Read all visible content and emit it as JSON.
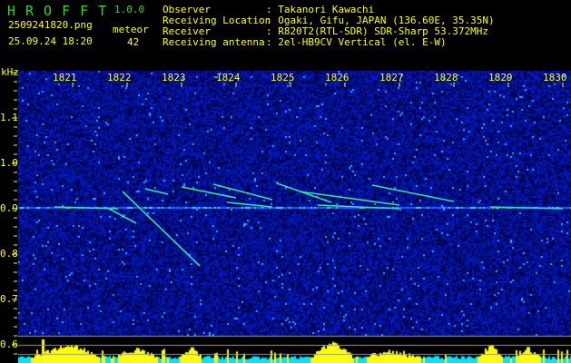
{
  "header": {
    "app_title": "HROFFT",
    "version": "1.0.0",
    "filename": "2509241820.png",
    "datetime": "25.09.24 18:20",
    "meteor_label": "meteor",
    "meteor_count": "42",
    "fields": [
      {
        "label": "Observer",
        "value": ": Takanori Kawachi"
      },
      {
        "label": "Receiving Location",
        "value": ": Ogaki, Gifu, JAPAN (136.60E, 35.35N)"
      },
      {
        "label": "Receiver",
        "value": ": R820T2(RTL-SDR) SDR-Sharp 53.372MHz"
      },
      {
        "label": "Receiving antenna",
        "value": ": 2el-HB9CV Vertical (el. E-W)"
      }
    ]
  },
  "axis": {
    "y_unit": "kHz",
    "y_ticks": [
      "1.1",
      "1.0",
      "0.9",
      "0.8",
      "0.7",
      "0.6"
    ],
    "x_ticks": [
      "1821",
      "1822",
      "1823",
      "1824",
      "1825",
      "1826",
      "1827",
      "1828",
      "1829",
      "1830"
    ]
  },
  "colors": {
    "text": "#ffff00",
    "title": "#22dd22",
    "noise": "#0a14a0",
    "signal": "#ffff00",
    "baseline": "#00e5ff"
  }
}
